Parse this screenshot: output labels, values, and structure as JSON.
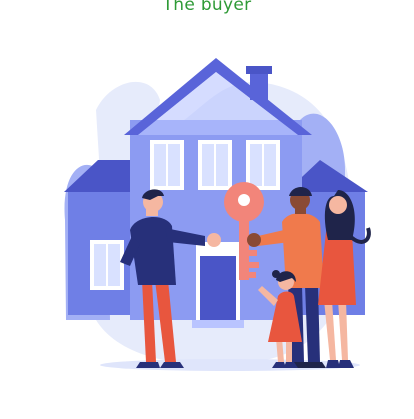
{
  "caption": {
    "text": "The buyer"
  },
  "illustration": {
    "subject": "house-key-handover",
    "colors": {
      "blob": "#e6ebfb",
      "house_light": "#8c9bf2",
      "house_mid": "#6f7fe6",
      "house_dark": "#4a55c7",
      "roof": "#5964d9",
      "window_glass": "#d9e1ff",
      "key": "#f2857a",
      "skin_light": "#f5b7a1",
      "skin_dark": "#8a4a34",
      "hair": "#1f244a",
      "red_clothes": "#e8563e",
      "orange_clothes": "#f07a4c",
      "navy": "#27307a"
    }
  }
}
